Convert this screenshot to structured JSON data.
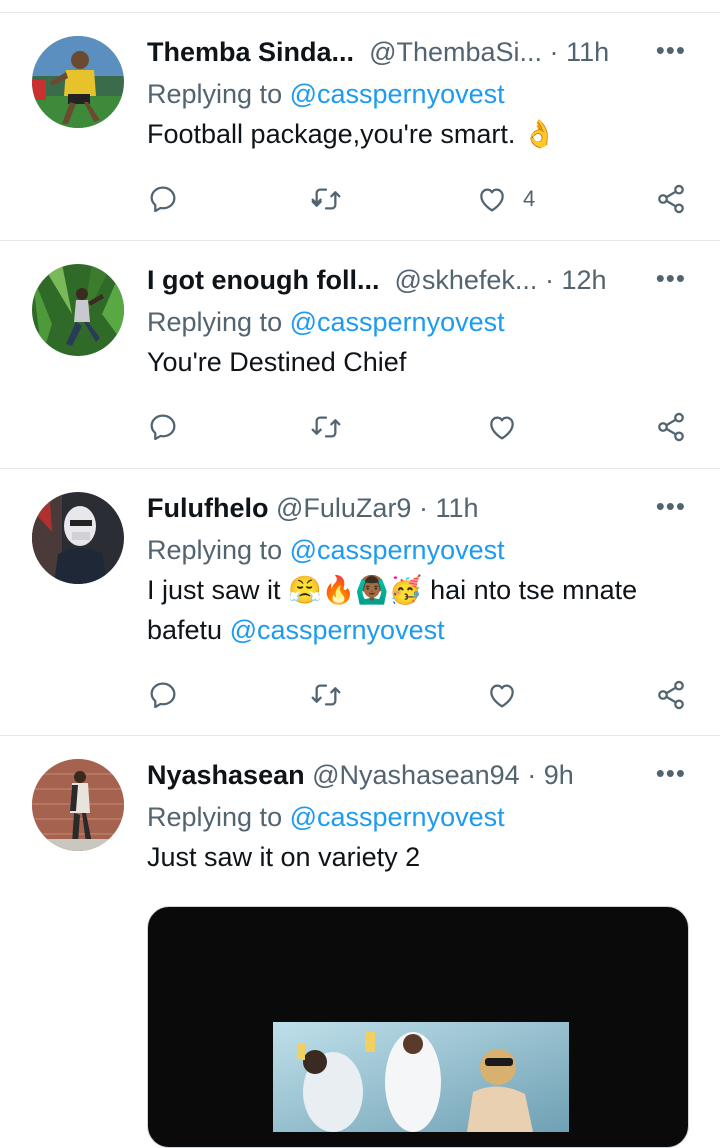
{
  "tweets": [
    {
      "name": "Themba Sinda...",
      "handle": "@ThembaSi...",
      "dot": "·",
      "time": "11h",
      "replying_prefix": "Replying to",
      "replying_to": "@casspernyovest",
      "text": "Football package,you're smart.",
      "text_emoji": "👌",
      "likes": "4"
    },
    {
      "name": "I got enough foll...",
      "handle": "@skhefek...",
      "dot": "·",
      "time": "12h",
      "replying_prefix": "Replying to",
      "replying_to": "@casspernyovest",
      "text": "You're Destined Chief",
      "likes": ""
    },
    {
      "name": "Fulufhelo",
      "handle": "@FuluZar9",
      "dot": "·",
      "time": "11h",
      "replying_prefix": "Replying to",
      "replying_to": "@casspernyovest",
      "text_before_emoji": "I just saw it",
      "emojis": "😤🔥🙆🏾‍♂️🥳",
      "text_after_emoji": "hai nto tse mnate",
      "text_line2": "bafetu",
      "text_line2_mention": "@casspernyovest",
      "likes": ""
    },
    {
      "name": "Nyashasean",
      "handle": "@Nyashasean94",
      "dot": "·",
      "time": "9h",
      "replying_prefix": "Replying to",
      "replying_to": "@casspernyovest",
      "text": "Just saw it on variety 2"
    }
  ],
  "more_icon": "•••",
  "icons": {
    "reply": "reply-icon",
    "retweet": "retweet-icon",
    "like": "heart-icon",
    "share": "share-icon"
  },
  "colors": {
    "accent": "#1d9bf0",
    "muted": "#536471",
    "text": "#0f1419",
    "divider": "#e6e9ec"
  }
}
